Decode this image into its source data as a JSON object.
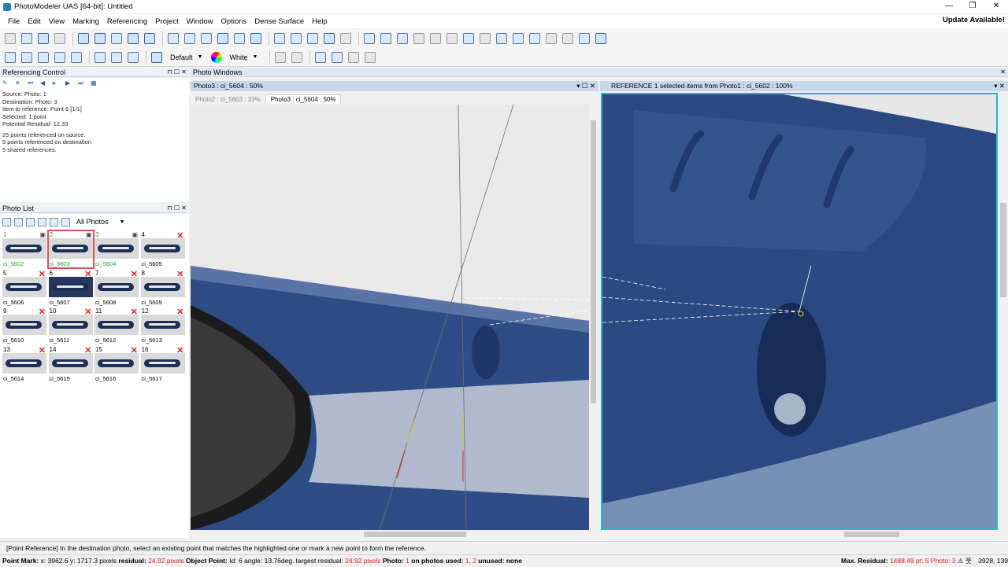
{
  "window": {
    "title": "PhotoModeler UAS [64-bit]: Untitled",
    "controls": [
      "—",
      "❐",
      "✕"
    ]
  },
  "menu": {
    "items": [
      "File",
      "Edit",
      "View",
      "Marking",
      "Referencing",
      "Project",
      "Window",
      "Options",
      "Dense Surface",
      "Help"
    ],
    "update": "Update Available!"
  },
  "toolbar2": {
    "layer_combo": "Default",
    "color_combo": "White"
  },
  "referencing_control": {
    "title": "Referencing Control",
    "lines": [
      "Source: Photo: 1",
      "Destination: Photo: 3",
      "Item to reference: Point 6 [1/1]",
      "Selected: 1 point",
      "Potential Residual: 12.33",
      "",
      "25 points referenced on source.",
      "5 points referenced on destination",
      "5 shared references."
    ]
  },
  "photo_list": {
    "title": "Photo List",
    "filter": "All Photos",
    "photos": [
      {
        "num": "1",
        "label": "ci_5602",
        "status": "cam",
        "green": true
      },
      {
        "num": "2",
        "label": "ci_5603",
        "status": "cam",
        "green": true,
        "selected": true
      },
      {
        "num": "3",
        "label": "ci_5604",
        "status": "cam",
        "green": true
      },
      {
        "num": "4",
        "label": "ci_5605",
        "status": "x"
      },
      {
        "num": "5",
        "label": "ci_5606",
        "status": "x"
      },
      {
        "num": "6",
        "label": "ci_5607",
        "status": "x",
        "dark": true
      },
      {
        "num": "7",
        "label": "ci_5608",
        "status": "x"
      },
      {
        "num": "8",
        "label": "ci_5609",
        "status": "x"
      },
      {
        "num": "9",
        "label": "ci_5610",
        "status": "x"
      },
      {
        "num": "10",
        "label": "ci_5611",
        "status": "x"
      },
      {
        "num": "11",
        "label": "ci_5612",
        "status": "x"
      },
      {
        "num": "12",
        "label": "ci_5613",
        "status": "x"
      },
      {
        "num": "13",
        "label": "ci_5614",
        "status": "x"
      },
      {
        "num": "14",
        "label": "ci_5615",
        "status": "x"
      },
      {
        "num": "15",
        "label": "ci_5616",
        "status": "x"
      },
      {
        "num": "16",
        "label": "ci_5617",
        "status": "x"
      }
    ]
  },
  "photo_windows": {
    "title": "Photo Windows",
    "left_pane_title": "Photo3 : ci_5604 : 50%",
    "tabs": [
      "Photo2 : ci_5603 : 33%",
      "Photo3 : ci_5604 : 50%"
    ],
    "right_pane_title": "REFERENCE 1 selected items from Photo1 : ci_5602 : 100%"
  },
  "status": {
    "message": "[Point Reference] In the destination photo, select an existing point that matches the highlighted one or mark a new point to form the reference.",
    "point_mark_label": "Point Mark:",
    "point_mark_coords": " x: 3962.6 y: 1717.3 pixels ",
    "residual_label": "residual: ",
    "residual_value": "24.92 pixels",
    "object_point_label": " Object Point:",
    "object_point_info": " Id: 6 angle: 13.76deg. largest residual: ",
    "largest_residual": "24.92 pixels",
    "photo_label": " Photo: ",
    "photo_value": "1",
    "on_photos": " on photos used: ",
    "photos_used": "1, 2",
    "unused": " unused: none",
    "max_residual_label": "Max. Residual:",
    "max_residual_value": "1488.49 pt: 5 Photo: 3",
    "coords": "3928, 139"
  },
  "colors": {
    "accent_cyan": "#28b8c8",
    "object_blue": "#2a4a80",
    "error_red": "#e02020"
  }
}
